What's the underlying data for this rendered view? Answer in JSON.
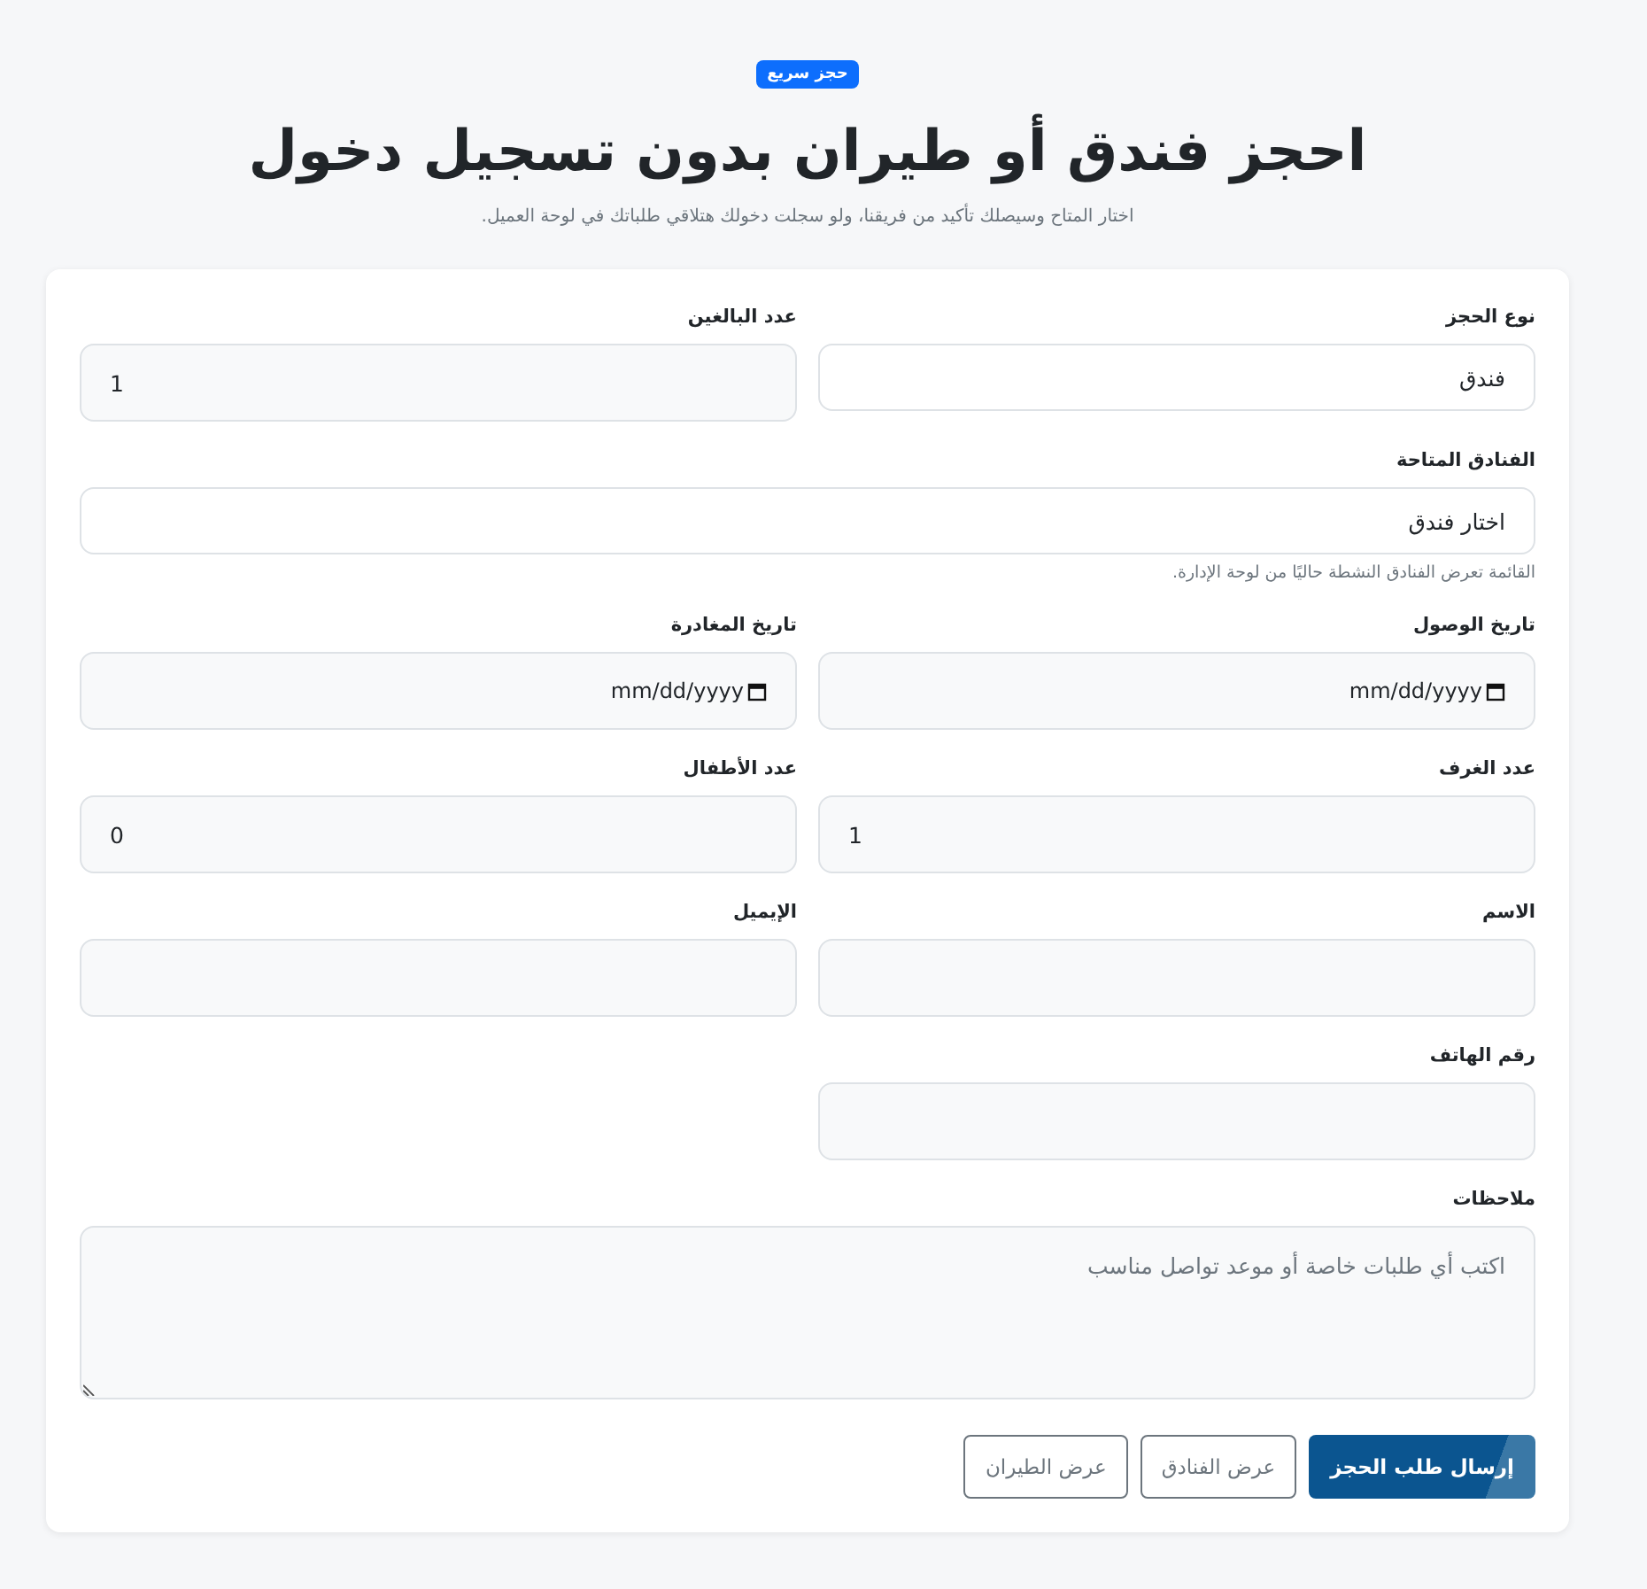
{
  "header": {
    "badge": "حجز سريع",
    "title": "احجز فندق أو طيران بدون تسجيل دخول",
    "subtitle": "اختار المتاح وسيصلك تأكيد من فريقنا، ولو سجلت دخولك هتلاقي طلباتك في لوحة العميل."
  },
  "fields": [
    {
      "kind": "select",
      "wide": false,
      "label": "نوع الحجز",
      "value": "فندق"
    },
    {
      "kind": "number",
      "wide": false,
      "label": "عدد البالغين",
      "value": "1"
    },
    {
      "kind": "select",
      "wide": true,
      "label": "الفنادق المتاحة",
      "value": "اختار فندق",
      "help": "القائمة تعرض الفنادق النشطة حاليًا من لوحة الإدارة."
    },
    {
      "kind": "date",
      "wide": false,
      "label": "تاريخ الوصول",
      "value": "mm/dd/yyyy"
    },
    {
      "kind": "date",
      "wide": false,
      "label": "تاريخ المغادرة",
      "value": "mm/dd/yyyy"
    },
    {
      "kind": "number",
      "wide": false,
      "label": "عدد الغرف",
      "value": "1"
    },
    {
      "kind": "number",
      "wide": false,
      "label": "عدد الأطفال",
      "value": "0"
    },
    {
      "kind": "text",
      "wide": false,
      "label": "الاسم"
    },
    {
      "kind": "text",
      "wide": false,
      "label": "الإيميل"
    },
    {
      "kind": "text",
      "wide": false,
      "label": "رقم الهاتف"
    },
    {
      "kind": "textarea",
      "wide": true,
      "label": "ملاحظات",
      "placeholder": "اكتب أي طلبات خاصة أو موعد تواصل مناسب"
    }
  ],
  "buttons": [
    {
      "kind": "primary",
      "label": "إرسال طلب الحجز"
    },
    {
      "kind": "outline",
      "label": "عرض الفنادق"
    },
    {
      "kind": "outline",
      "label": "عرض الطيران"
    }
  ]
}
